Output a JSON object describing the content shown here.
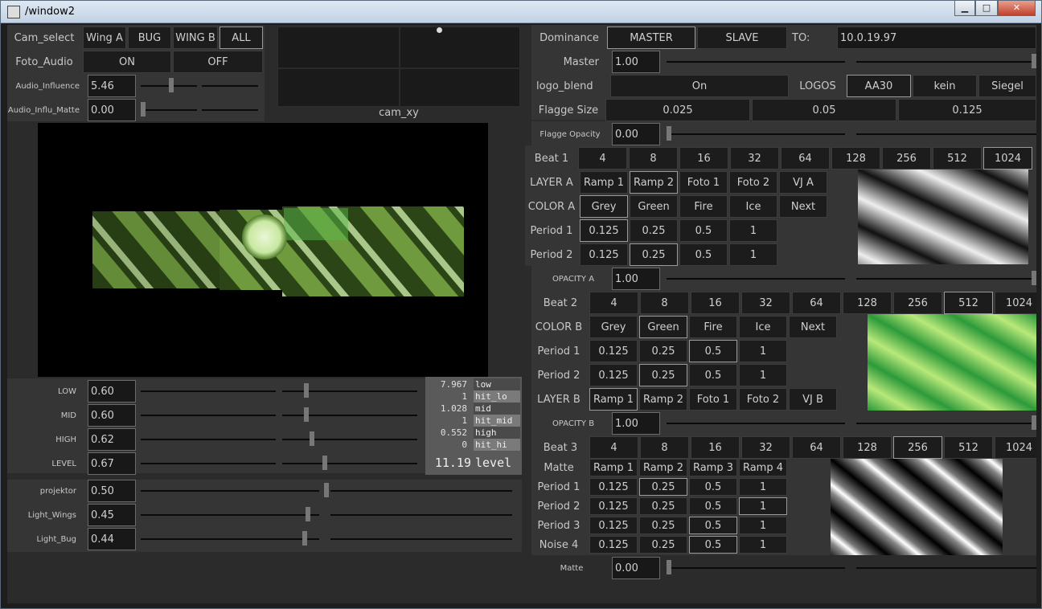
{
  "window": {
    "title": "/window2",
    "min": "▁",
    "max": "□",
    "close": "✕"
  },
  "left": {
    "cam_select": {
      "label": "Cam_select",
      "options": [
        "Wing A",
        "BUG",
        "WING B",
        "ALL"
      ]
    },
    "foto_audio": {
      "label": "Foto_Audio",
      "on": "ON",
      "off": "OFF"
    },
    "audio_influence": {
      "label": "Audio_Influence",
      "value": "5.46",
      "level": 0.55
    },
    "audio_influ_matte": {
      "label": "Audio_Influ_Matte",
      "value": "0.00",
      "level": 0.0
    },
    "cam_xy": {
      "label": "cam_xy"
    },
    "bands": [
      {
        "label": "LOW",
        "value": "0.60",
        "level": 0.6
      },
      {
        "label": "MID",
        "value": "0.60",
        "level": 0.6
      },
      {
        "label": "HIGH",
        "value": "0.62",
        "level": 0.62
      },
      {
        "label": "LEVEL",
        "value": "0.67",
        "level": 0.67
      }
    ],
    "meter": [
      {
        "num": "7.967",
        "name": "low"
      },
      {
        "num": "1",
        "name": "hit_lo"
      },
      {
        "num": "1.028",
        "name": "mid"
      },
      {
        "num": "1",
        "name": "hit_mid"
      },
      {
        "num": "0.552",
        "name": "high"
      },
      {
        "num": "0",
        "name": "hit_hi"
      }
    ],
    "meter_level": {
      "num": "11.19",
      "name": "level"
    },
    "lights": [
      {
        "label": "projektor",
        "value": "0.50",
        "level": 0.5
      },
      {
        "label": "Light_Wings",
        "value": "0.45",
        "level": 0.45
      },
      {
        "label": "Light_Bug",
        "value": "0.44",
        "level": 0.44
      }
    ]
  },
  "right": {
    "dominance": {
      "label": "Dominance",
      "master": "MASTER",
      "slave": "SLAVE",
      "to_label": "TO:",
      "to_value": "10.0.19.97"
    },
    "master": {
      "label": "Master",
      "value": "1.00",
      "level": 1.0
    },
    "logo_blend": {
      "label": "logo_blend",
      "value": "On",
      "logos_label": "LOGOS",
      "logos": [
        "AA30",
        "kein",
        "Siegel"
      ]
    },
    "flagge_size": {
      "label": "Flagge Size",
      "values": [
        "0.025",
        "0.05",
        "0.125"
      ]
    },
    "flagge_opacity": {
      "label": "Flagge Opacity",
      "value": "0.00",
      "level": 0.0
    },
    "beats": [
      "4",
      "8",
      "16",
      "32",
      "64",
      "128",
      "256",
      "512",
      "1024"
    ],
    "beat1": {
      "label": "Beat 1",
      "selected": "1024"
    },
    "layer_a": {
      "label": "LAYER A",
      "options": [
        "Ramp 1",
        "Ramp 2",
        "Foto 1",
        "Foto 2",
        "VJ A"
      ]
    },
    "color_a": {
      "label": "COLOR A",
      "options": [
        "Grey",
        "Green",
        "Fire",
        "Ice",
        "Next"
      ]
    },
    "periods": [
      "0.125",
      "0.25",
      "0.5",
      "1"
    ],
    "period1_a": {
      "label": "Period 1"
    },
    "period2_a": {
      "label": "Period 2"
    },
    "opacity_a": {
      "label": "OPACITY A",
      "value": "1.00",
      "level": 1.0
    },
    "beat2": {
      "label": "Beat 2",
      "selected": "512"
    },
    "color_b": {
      "label": "COLOR B",
      "options": [
        "Grey",
        "Green",
        "Fire",
        "Ice",
        "Next"
      ]
    },
    "period1_b": {
      "label": "Period 1"
    },
    "period2_b": {
      "label": "Period 2"
    },
    "layer_b": {
      "label": "LAYER B",
      "options": [
        "Ramp 1",
        "Ramp 2",
        "Foto 1",
        "Foto 2",
        "VJ B"
      ]
    },
    "opacity_b": {
      "label": "OPACITY B",
      "value": "1.00",
      "level": 1.0
    },
    "beat3": {
      "label": "Beat 3",
      "selected": "256"
    },
    "matte": {
      "label": "Matte",
      "options": [
        "Ramp 1",
        "Ramp 2",
        "Ramp 3",
        "Ramp 4"
      ]
    },
    "matte_periods": [
      {
        "label": "Period 1"
      },
      {
        "label": "Period 2"
      },
      {
        "label": "Period 3"
      },
      {
        "label": "Noise 4"
      }
    ],
    "matte_slider": {
      "label": "Matte",
      "value": "0.00",
      "level": 0.0
    }
  }
}
